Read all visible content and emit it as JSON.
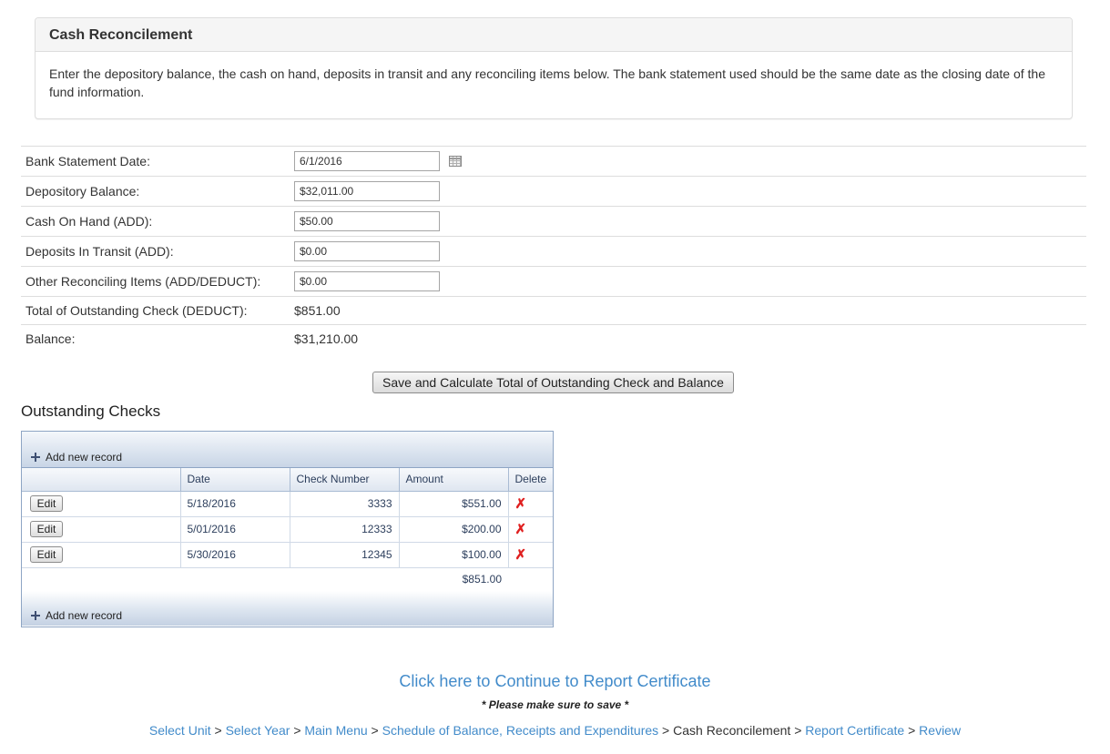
{
  "panel": {
    "title": "Cash Reconcilement",
    "description": "Enter the depository balance, the cash on hand, deposits in transit and any reconciling items below. The bank statement used should be the same date as the closing date of the fund information."
  },
  "form": {
    "bank_statement_date": {
      "label": "Bank Statement Date:",
      "value": "6/1/2016",
      "icon": "calendar-icon"
    },
    "depository_balance": {
      "label": "Depository Balance:",
      "value": "$32,011.00"
    },
    "cash_on_hand": {
      "label": "Cash On Hand (ADD):",
      "value": "$50.00"
    },
    "deposits_in_transit": {
      "label": "Deposits In Transit (ADD):",
      "value": "$0.00"
    },
    "other_reconciling": {
      "label": "Other Reconciling Items (ADD/DEDUCT):",
      "value": "$0.00"
    },
    "total_outstanding": {
      "label": "Total of Outstanding Check (DEDUCT):",
      "value": "$851.00"
    },
    "balance": {
      "label": "Balance:",
      "value": "$31,210.00"
    }
  },
  "save_button_label": "Save and Calculate Total of Outstanding Check and Balance",
  "outstanding_checks": {
    "title": "Outstanding Checks",
    "add_record_label": "Add new record",
    "columns": [
      "",
      "Date",
      "Check Number",
      "Amount",
      "Delete"
    ],
    "rows": [
      {
        "edit_label": "Edit",
        "date": "5/18/2016",
        "check_number": "3333",
        "amount": "$551.00"
      },
      {
        "edit_label": "Edit",
        "date": "5/01/2016",
        "check_number": "12333",
        "amount": "$200.00"
      },
      {
        "edit_label": "Edit",
        "date": "5/30/2016",
        "check_number": "12345",
        "amount": "$100.00"
      }
    ],
    "footer_total": "$851.00",
    "delete_icon": "delete-x-icon"
  },
  "continue_link": "Click here to Continue to Report Certificate",
  "save_note": "* Please make sure to save *",
  "breadcrumb": {
    "separator": ">",
    "items": [
      {
        "label": "Select Unit",
        "link": true
      },
      {
        "label": "Select Year",
        "link": true
      },
      {
        "label": "Main Menu",
        "link": true
      },
      {
        "label": "Schedule of Balance, Receipts and Expenditures",
        "link": true
      },
      {
        "label": "Cash Reconcilement",
        "link": false
      },
      {
        "label": "Report Certificate",
        "link": true
      },
      {
        "label": "Review",
        "link": true
      }
    ]
  },
  "colors": {
    "link": "#428bca",
    "delete": "#e02020",
    "grid_border": "#8ea5c4"
  }
}
